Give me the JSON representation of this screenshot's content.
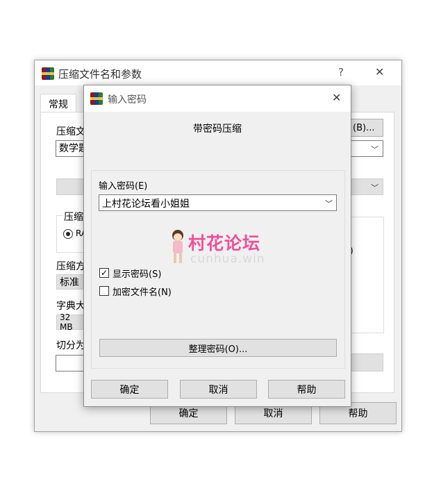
{
  "back_window": {
    "title": "压缩文件名和参数",
    "help_glyph": "?",
    "close_glyph": "✕",
    "tab_general": "常规",
    "archive_name_label": "压缩文",
    "archive_name_value": "数学题",
    "browse_suffix": "(B)...",
    "compression_format_label": "压缩",
    "format_radio_label": "RA",
    "compression_method_label": "压缩方",
    "compression_method_value": "标准",
    "dictionary_label": "字典大",
    "dictionary_value": "32 MB",
    "split_label": "切分为",
    "right_option_fragment": ")",
    "ok_label": "确定",
    "cancel_label": "取消",
    "help_label": "帮助"
  },
  "front_dialog": {
    "title": "输入密码",
    "close_glyph": "✕",
    "heading": "带密码压缩",
    "password_label": "输入密码(E)",
    "password_value": "上村花论坛看小姐姐",
    "show_password_label": "显示密码(S)",
    "show_password_checked": true,
    "encrypt_filenames_label": "加密文件名(N)",
    "encrypt_filenames_checked": false,
    "organize_label": "整理密码(O)...",
    "ok_label": "确定",
    "cancel_label": "取消",
    "help_label": "帮助"
  },
  "watermark": {
    "brand": "村花论坛",
    "domain": "cunhua.win"
  },
  "icons": {
    "app": "winrar-icon",
    "dropdown": "chevron-down-icon",
    "check": "checkmark-icon"
  },
  "colors": {
    "watermark_pink": "#f0509a",
    "dialog_bg": "#f0f0f0",
    "button_bg": "#e1e1e1"
  }
}
